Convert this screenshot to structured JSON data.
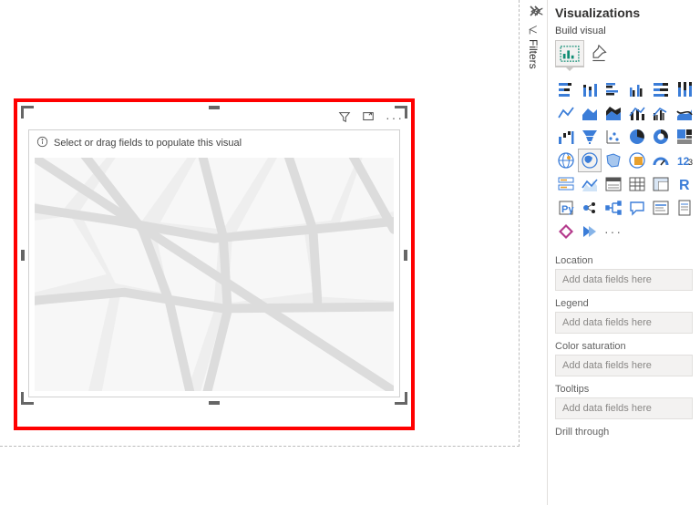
{
  "panel": {
    "title": "Visualizations",
    "subhead": "Build visual",
    "drillThrough": "Drill through",
    "moreDots": "···"
  },
  "filtersTab": "Filters",
  "visual": {
    "hint": "Select or drag fields to populate this visual"
  },
  "fields": [
    {
      "label": "Location",
      "placeholder": "Add data fields here"
    },
    {
      "label": "Legend",
      "placeholder": "Add data fields here"
    },
    {
      "label": "Color saturation",
      "placeholder": "Add data fields here"
    },
    {
      "label": "Tooltips",
      "placeholder": "Add data fields here"
    }
  ]
}
